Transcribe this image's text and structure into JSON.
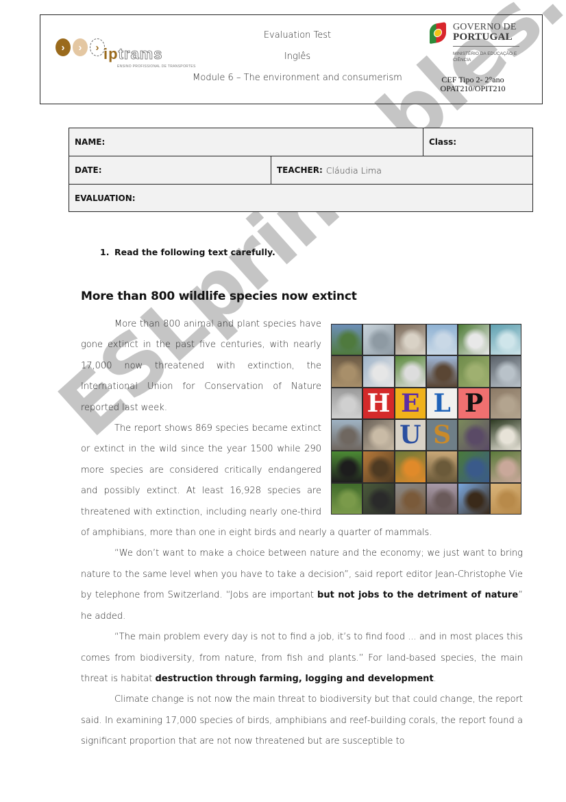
{
  "header": {
    "left_logo": {
      "brand_prefix": "ip",
      "brand_suffix": "trams",
      "chevron": "›",
      "tagline": "ENSINO PROFISSIONAL DE TRANSPORTES"
    },
    "title": "Evaluation Test",
    "subject": "Inglês",
    "module": "Module 6 – The environment and consumerism",
    "right_logo": {
      "line1": "GOVERNO DE",
      "line2": "PORTUGAL",
      "line3": "MINISTÉRIO DA EDUCAÇÃO E CIÊNCIA"
    },
    "course_line1": "CEF Tipo 2- 2°ano",
    "course_line2": "OPAT210/OPIT210"
  },
  "info_table": {
    "name_label": "NAME:",
    "name_value": "",
    "class_label": "Class:",
    "class_value": "",
    "date_label": "DATE:",
    "date_value": "",
    "teacher_label": "TEACHER:",
    "teacher_value": "Cláudia Lima",
    "evaluation_label": "EVALUATION:",
    "evaluation_value": ""
  },
  "instruction": {
    "number": "1.",
    "text": "Read the following text carefully."
  },
  "article": {
    "title": "More than 800 wildlife species now extinct",
    "p1": "More than 800 animal and plant species have gone extinct in the past five centuries, with nearly 17,000 now threatened with extinction, the International Union for Conservation of Nature reported last week.",
    "p2": "The report shows 869 species became extinct or extinct in the wild since the year 1500 while 290 more species are considered critically endangered and possibly extinct. At least 16,928 species are threatened with extinction, including nearly one-third of amphibians, more than one in eight birds and nearly a quarter of mammals.",
    "p3_a": "“We don’t want to make a choice between nature and the economy; we just want to bring nature to the same level when you have to take a decision”, said report editor Jean-Christophe Vie by telephone from Switzerland. “Jobs are important ",
    "p3_bold": "but not jobs to the detriment of nature",
    "p3_b": "” he added.",
    "p4_a": "“The main problem every day is not to find a job, it’s to find food ... and in most places this comes from biodiversity, from nature, from fish and plants.” For land-based species, the main threat is habitat ",
    "p4_bold": "destruction through farming, logging and development",
    "p4_b": ".",
    "p5": "Climate change is not now the main threat to biodiversity but that could change, the report said. In examining 17,000 species of birds, amphibians and reef-building corals, the report found a significant proportion that are not now threatened but are susceptible to"
  },
  "collage": {
    "description": "HELP US animal photo collage",
    "tiles": [
      {
        "subject": "mountain lake",
        "colors": [
          "#6d8fb8",
          "#4f7a3e"
        ]
      },
      {
        "subject": "snow leopard",
        "colors": [
          "#c9d4dc",
          "#8e9aa3"
        ]
      },
      {
        "subject": "lemur",
        "colors": [
          "#7b6a5a",
          "#d9d2c6"
        ]
      },
      {
        "subject": "crane",
        "colors": [
          "#8fb2d3",
          "#c9d8e6"
        ]
      },
      {
        "subject": "panda",
        "colors": [
          "#4c7a34",
          "#e8e8e8"
        ]
      },
      {
        "subject": "water",
        "colors": [
          "#5fa0b0",
          "#cfe5ea"
        ]
      },
      {
        "subject": "ocelot",
        "colors": [
          "#6b5a45",
          "#a88f6a"
        ]
      },
      {
        "subject": "seal pup",
        "colors": [
          "#9fb4c9",
          "#e6e6e6"
        ]
      },
      {
        "subject": "zebra",
        "colors": [
          "#5b8a3c",
          "#ddd"
        ]
      },
      {
        "subject": "bear",
        "colors": [
          "#9fb6d6",
          "#5a4634"
        ]
      },
      {
        "subject": "wetland",
        "colors": [
          "#6e8b4a",
          "#9fb070"
        ]
      },
      {
        "subject": "whale",
        "colors": [
          "#596068",
          "#b9c2c9"
        ]
      },
      {
        "subject": "elephant",
        "colors": [
          "#9a9a9a",
          "#d0d0d0"
        ]
      },
      {
        "subject": "letter",
        "letter": "H",
        "bg": "#d42a2a",
        "fg": "#ffffff"
      },
      {
        "subject": "letter",
        "letter": "E",
        "bg": "#f0b21b",
        "fg": "#5d2ea6"
      },
      {
        "subject": "letter",
        "letter": "L",
        "bg": "#f1f1ee",
        "fg": "#1f63b8"
      },
      {
        "subject": "letter",
        "letter": "P",
        "bg": "#f07070",
        "fg": "#111111"
      },
      {
        "subject": "tree bark",
        "colors": [
          "#8c7a66",
          "#b3a48f"
        ]
      },
      {
        "subject": "seal",
        "colors": [
          "#9fb3c4",
          "#6f6760"
        ]
      },
      {
        "subject": "wolf",
        "colors": [
          "#6b6258",
          "#c9bba6"
        ]
      },
      {
        "subject": "letter",
        "letter": "U",
        "bg": "#d9d3c7",
        "fg": "#2a4fa0"
      },
      {
        "subject": "letter",
        "letter": "S",
        "bg": "#6f7f88",
        "fg": "#c98a2a"
      },
      {
        "subject": "pigeon",
        "colors": [
          "#7b8a5a",
          "#5a4a66"
        ]
      },
      {
        "subject": "sheep",
        "colors": [
          "#2d3a22",
          "#e7e3d8"
        ]
      },
      {
        "subject": "monkey",
        "colors": [
          "#4c8a34",
          "#1d1d1d"
        ]
      },
      {
        "subject": "tiger",
        "colors": [
          "#b87a3a",
          "#4e3a22"
        ]
      },
      {
        "subject": "butterfly",
        "colors": [
          "#6d7a3a",
          "#e08a2a"
        ]
      },
      {
        "subject": "cheetah",
        "colors": [
          "#c9a878",
          "#6b5a3a"
        ]
      },
      {
        "subject": "parrot",
        "colors": [
          "#4a7a3a",
          "#3a5a8a"
        ]
      },
      {
        "subject": "lynx",
        "colors": [
          "#5a7a3a",
          "#c9a89a"
        ]
      },
      {
        "subject": "moss forest",
        "colors": [
          "#3f6a2a",
          "#7a9a4a"
        ]
      },
      {
        "subject": "gorilla",
        "colors": [
          "#4a5a3a",
          "#2a2a2a"
        ]
      },
      {
        "subject": "deer",
        "colors": [
          "#8a8a8a",
          "#7a5a3a"
        ]
      },
      {
        "subject": "rocks",
        "colors": [
          "#a89aa8",
          "#6a5a5a"
        ]
      },
      {
        "subject": "eagle",
        "colors": [
          "#7aa8e0",
          "#3a2a1a"
        ]
      },
      {
        "subject": "desert sand",
        "colors": [
          "#d9b47a",
          "#b88a4a"
        ]
      }
    ]
  },
  "watermark": {
    "text": "ESLprintables.com"
  }
}
